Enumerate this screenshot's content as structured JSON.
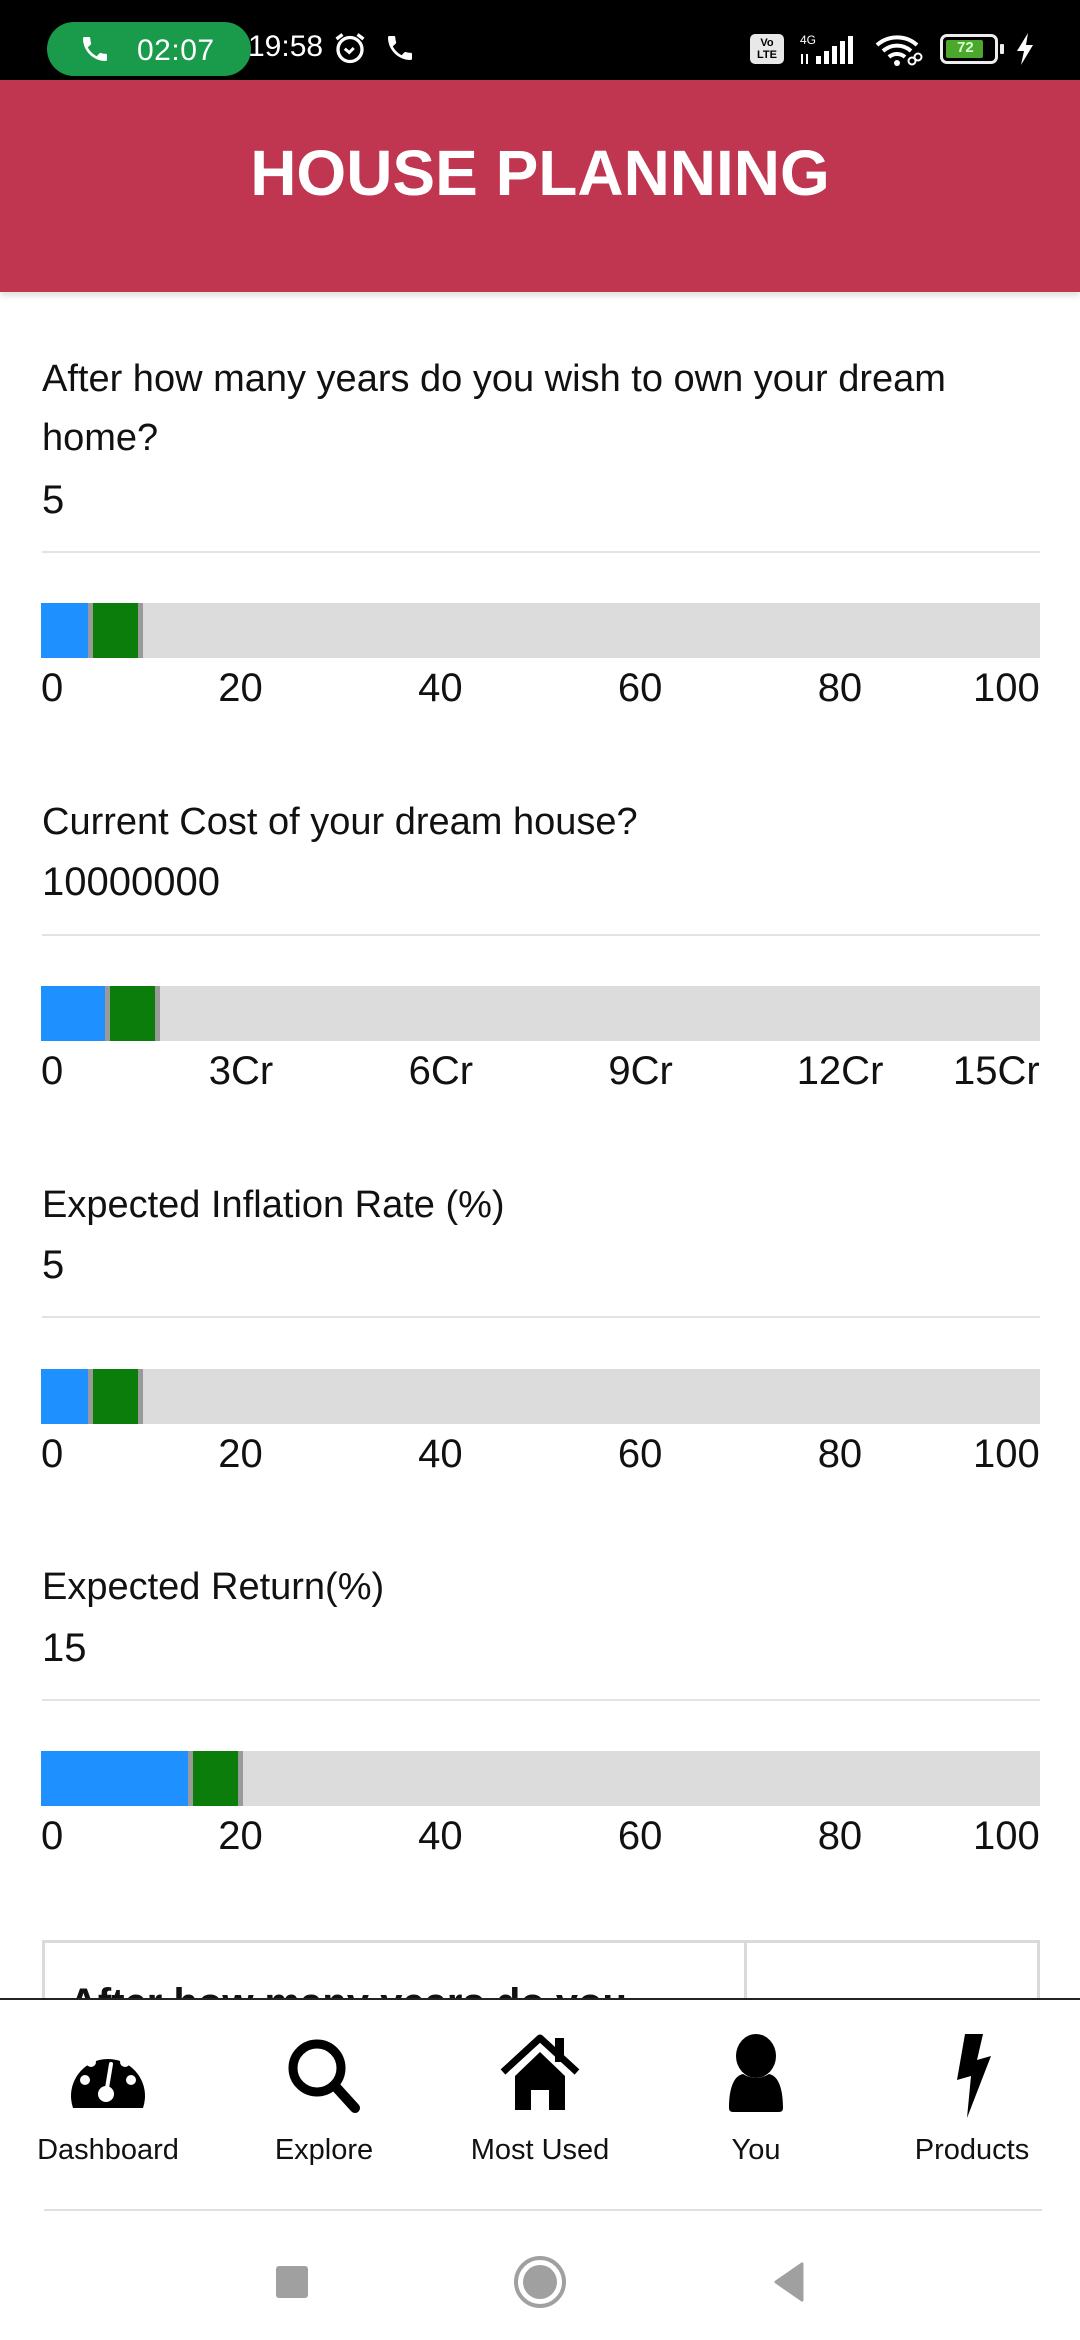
{
  "status_bar": {
    "call_timer": "02:07",
    "time": "19:58",
    "network_type": "4G",
    "volte_label": "Vo LTE",
    "battery_percent": "72",
    "icons": [
      "phone-call-icon",
      "alarm-icon",
      "phone-icon",
      "volte-icon",
      "signal-icon",
      "wifi-icon",
      "battery-icon",
      "charging-icon"
    ]
  },
  "header": {
    "title": "HOUSE PLANNING",
    "color": "#c0354f"
  },
  "form": {
    "questions": [
      {
        "label": "After how many years do you wish to own your dream home?",
        "value": "5",
        "slider": {
          "min": 0,
          "max": 100,
          "value": 5,
          "ticks": [
            "0",
            "20",
            "40",
            "60",
            "80",
            "100"
          ]
        }
      },
      {
        "label": "Current Cost of your dream house?",
        "value": "10000000",
        "slider": {
          "min": 0,
          "max": 150000000,
          "value": 10000000,
          "ticks": [
            "0",
            "3Cr",
            "6Cr",
            "9Cr",
            "12Cr",
            "15Cr"
          ]
        }
      },
      {
        "label": "Expected Inflation Rate (%)",
        "value": "5",
        "slider": {
          "min": 0,
          "max": 100,
          "value": 5,
          "ticks": [
            "0",
            "20",
            "40",
            "60",
            "80",
            "100"
          ]
        }
      },
      {
        "label": "Expected Return(%)",
        "value": "15",
        "slider": {
          "min": 0,
          "max": 100,
          "value": 15,
          "ticks": [
            "0",
            "20",
            "40",
            "60",
            "80",
            "100"
          ]
        }
      }
    ],
    "slider_colors": {
      "fill": "#1e90ff",
      "thumb": "#0a7d0a",
      "track": "#dcdcdc"
    }
  },
  "result_table": {
    "first_row_label": "After how many years do you"
  },
  "bottom_nav": {
    "items": [
      {
        "label": "Dashboard",
        "icon": "dashboard-gauge-icon"
      },
      {
        "label": "Explore",
        "icon": "search-icon"
      },
      {
        "label": "Most Used",
        "icon": "home-icon"
      },
      {
        "label": "You",
        "icon": "user-icon"
      },
      {
        "label": "Products",
        "icon": "lightning-icon"
      }
    ]
  },
  "system_nav": {
    "buttons": [
      "recents-button",
      "home-button",
      "back-button"
    ]
  }
}
